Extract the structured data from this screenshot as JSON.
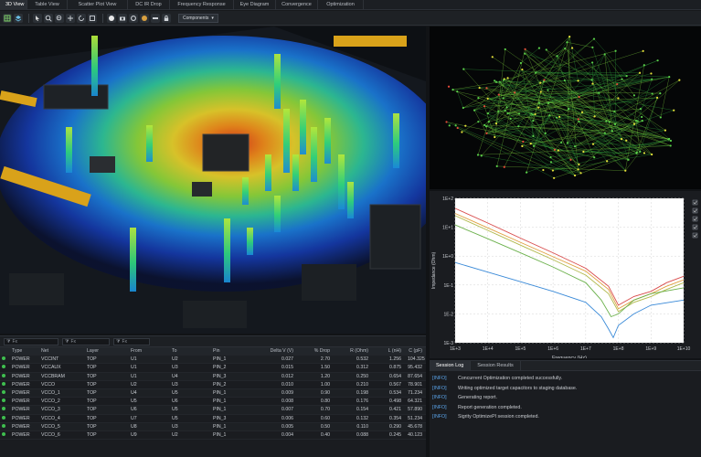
{
  "tabs": [
    {
      "label": "3D View",
      "active": true
    },
    {
      "label": "Table View",
      "active": false
    },
    {
      "label": "Scatter Plot View",
      "active": false
    },
    {
      "label": "DC IR Drop",
      "active": false
    },
    {
      "label": "Frequency Response",
      "active": false
    },
    {
      "label": "Eye Diagram",
      "active": false
    },
    {
      "label": "Convergence",
      "active": false
    },
    {
      "label": "Optimization",
      "active": false
    }
  ],
  "toolbar": {
    "dropdown_label": "Components",
    "icons": [
      "grid-icon",
      "layers-icon",
      "select-icon",
      "zoom-in-icon",
      "zoom-out-icon",
      "pan-icon",
      "rotate-icon",
      "fit-icon",
      "sphere-icon",
      "camera-icon",
      "settings-icon",
      "palette-icon",
      "ruler-icon",
      "lock-icon"
    ]
  },
  "colors": {
    "accent": "#3fbf4f",
    "log_tag": "#5aa3e8",
    "background": "#16181b"
  },
  "table": {
    "filters": [
      "Fx",
      "Fx",
      "Fx"
    ],
    "columns": [
      "Type",
      "Net",
      "Layer",
      "From",
      "To",
      "Pin",
      "Delta V (V)",
      "% Drop",
      "R (Ohm)",
      "L (nH)",
      "C (pF)"
    ],
    "rows": [
      [
        "POWER",
        "VCCINT",
        "TOP",
        "U1",
        "U2",
        "PIN_1",
        "0.027",
        "2.70",
        "0.532",
        "1.256",
        "104.325"
      ],
      [
        "POWER",
        "VCCAUX",
        "TOP",
        "U1",
        "U3",
        "PIN_2",
        "0.015",
        "1.50",
        "0.312",
        "0.875",
        "95.432"
      ],
      [
        "POWER",
        "VCCBRAM",
        "TOP",
        "U1",
        "U4",
        "PIN_3",
        "0.012",
        "1.20",
        "0.250",
        "0.654",
        "87.654"
      ],
      [
        "POWER",
        "VCCO",
        "TOP",
        "U2",
        "U3",
        "PIN_2",
        "0.010",
        "1.00",
        "0.210",
        "0.567",
        "78.901"
      ],
      [
        "POWER",
        "VCCO_1",
        "TOP",
        "U4",
        "U5",
        "PIN_1",
        "0.009",
        "0.90",
        "0.198",
        "0.534",
        "71.234"
      ],
      [
        "POWER",
        "VCCO_2",
        "TOP",
        "U5",
        "U6",
        "PIN_1",
        "0.008",
        "0.80",
        "0.176",
        "0.498",
        "64.321"
      ],
      [
        "POWER",
        "VCCO_3",
        "TOP",
        "U6",
        "U5",
        "PIN_1",
        "0.007",
        "0.70",
        "0.154",
        "0.421",
        "57.890"
      ],
      [
        "POWER",
        "VCCO_4",
        "TOP",
        "U7",
        "U5",
        "PIN_3",
        "0.006",
        "0.60",
        "0.132",
        "0.354",
        "51.234"
      ],
      [
        "POWER",
        "VCCO_5",
        "TOP",
        "U8",
        "U3",
        "PIN_1",
        "0.005",
        "0.50",
        "0.110",
        "0.290",
        "45.678"
      ],
      [
        "POWER",
        "VCCO_6",
        "TOP",
        "U9",
        "U2",
        "PIN_1",
        "0.004",
        "0.40",
        "0.088",
        "0.245",
        "40.123"
      ]
    ]
  },
  "log": {
    "tabs": [
      {
        "label": "Session Log",
        "active": true
      },
      {
        "label": "Session Results",
        "active": false
      }
    ],
    "entries": [
      {
        "tag": "[INFO]",
        "msg": "Concurrent Optimization completed successfully."
      },
      {
        "tag": "[INFO]",
        "msg": "Writing optimized target capacitors to staging database."
      },
      {
        "tag": "[INFO]",
        "msg": "Generating report."
      },
      {
        "tag": "[INFO]",
        "msg": "Report generation completed."
      },
      {
        "tag": "[INFO]",
        "msg": "Sigrity OptimizePI session completed."
      }
    ]
  },
  "chart_data": {
    "type": "line",
    "title": "",
    "xlabel": "Frequency (Hz)",
    "ylabel": "Impedance (Ohm)",
    "xscale": "log",
    "yscale": "log",
    "xlim": [
      1000,
      10000000000
    ],
    "ylim": [
      0.001,
      100
    ],
    "x_ticks": [
      "1E+3",
      "1E+4",
      "1E+5",
      "1E+6",
      "1E+7",
      "1E+8",
      "1E+9",
      "1E+10"
    ],
    "y_ticks": [
      "1E+2",
      "1E+1",
      "1E+0",
      "1E-1",
      "1E-2",
      "1E-3"
    ],
    "grid": true,
    "series": [
      {
        "color": "#d84a4a",
        "x": [
          1000,
          10000,
          100000,
          1000000,
          10000000,
          50000000,
          100000000,
          300000000,
          1000000000,
          3000000000,
          10000000000
        ],
        "y": [
          45,
          14,
          4.2,
          1.3,
          0.38,
          0.09,
          0.02,
          0.04,
          0.06,
          0.12,
          0.2
        ]
      },
      {
        "color": "#e0a040",
        "x": [
          1000,
          10000,
          100000,
          1000000,
          10000000,
          50000000,
          100000000,
          300000000,
          1000000000,
          3000000000,
          10000000000
        ],
        "y": [
          30,
          9.5,
          3.0,
          0.95,
          0.3,
          0.07,
          0.015,
          0.03,
          0.05,
          0.09,
          0.15
        ]
      },
      {
        "color": "#b0b84a",
        "x": [
          1000,
          10000,
          100000,
          1000000,
          10000000,
          50000000,
          100000000,
          300000000,
          1000000000,
          3000000000,
          10000000000
        ],
        "y": [
          25,
          7.8,
          2.4,
          0.75,
          0.22,
          0.05,
          0.012,
          0.025,
          0.04,
          0.07,
          0.12
        ]
      },
      {
        "color": "#6ab04a",
        "x": [
          1000,
          10000,
          100000,
          1000000,
          10000000,
          30000000,
          60000000,
          100000000,
          300000000,
          1000000000,
          10000000000
        ],
        "y": [
          12,
          4.0,
          1.3,
          0.42,
          0.12,
          0.03,
          0.008,
          0.01,
          0.03,
          0.05,
          0.08
        ]
      },
      {
        "color": "#3a8ad8",
        "x": [
          1000,
          10000,
          100000,
          1000000,
          10000000,
          30000000,
          50000000,
          70000000,
          100000000,
          300000000,
          1000000000,
          10000000000
        ],
        "y": [
          0.6,
          0.28,
          0.13,
          0.06,
          0.025,
          0.008,
          0.003,
          0.0015,
          0.004,
          0.01,
          0.02,
          0.03
        ]
      }
    ]
  }
}
